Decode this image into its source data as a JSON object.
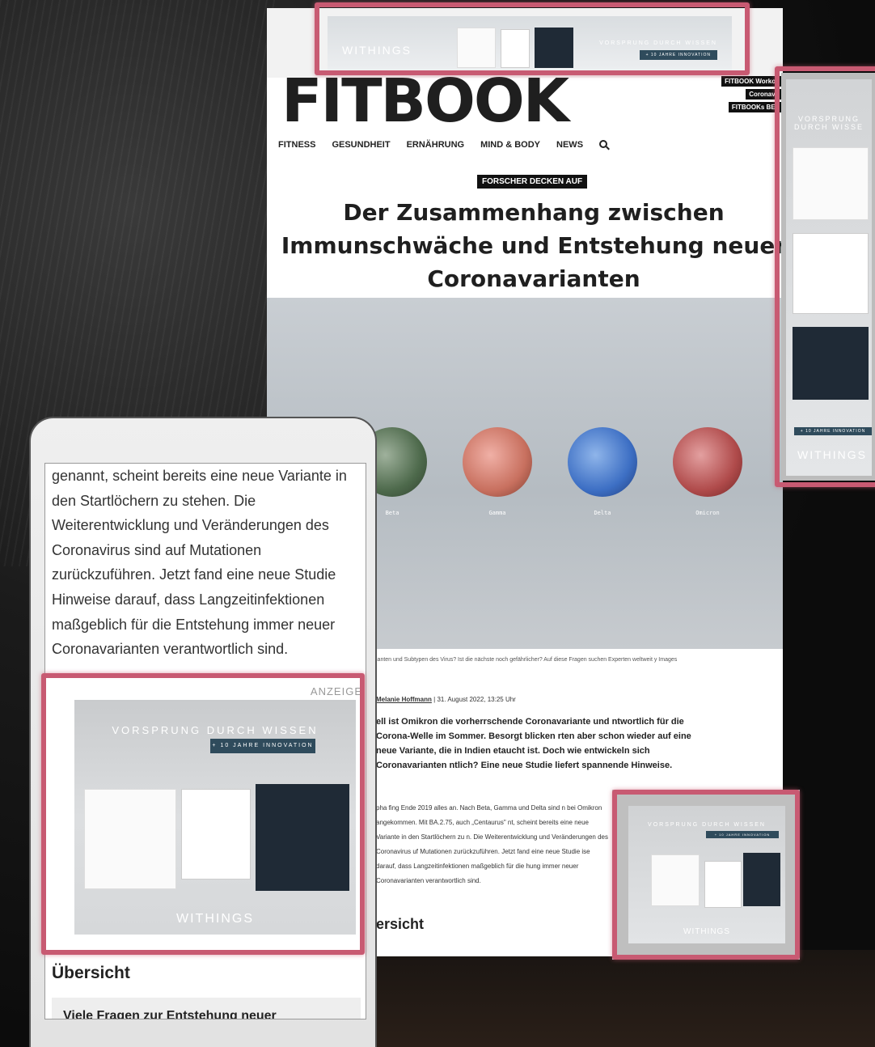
{
  "site": {
    "logo": "FITBOOK",
    "quick_links": [
      "FITBOOK Workou",
      "Coronavir",
      "FITBOOKs BES"
    ],
    "nav": [
      "FITNESS",
      "GESUNDHEIT",
      "ERNÄHRUNG",
      "MIND & BODY",
      "NEWS"
    ]
  },
  "ad_top": {
    "brand": "WITHINGS",
    "tagline": "VORSPRUNG DURCH WISSEN",
    "pill": "+ 10 JAHRE INNOVATION"
  },
  "ad_side": {
    "tagline": "VORSPRUNG DURCH WISSE",
    "pill": "+ 10 JAHRE INNOVATION",
    "brand": "WITHINGS"
  },
  "article": {
    "kicker": "FORSCHER DECKEN AUF",
    "headline": "Der Zusammenhang zwischen Immunschwäche und Entstehung neuer Coronavarianten",
    "variants": [
      "Beta",
      "Gamma",
      "Delta",
      "Omicron"
    ],
    "caption": "ianten und Subtypen des Virus? Ist die nächste noch gefährlicher? Auf diese Fragen suchen Experten weltweit y Images",
    "author": "Melanie Hoffmann",
    "date": "| 31. August 2022, 13:25 Uhr",
    "lead": "ell ist Omikron die vorherrschende Coronavariante und ntwortlich für die Corona-Welle im Sommer. Besorgt blicken rten aber schon wieder auf eine neue Variante, die in Indien etaucht ist. Doch wie entwickeln sich Coronavarianten ntlich? Eine neue Studie liefert spannende Hinweise.",
    "body": "pha fing Ende 2019 alles an. Nach Beta, Gamma und Delta sind n bei Omikron angekommen. Mit BA.2.75, auch „Centaurus\" nt, scheint bereits eine neue Variante in den Startlöchern zu n. Die Weiterentwicklung und Veränderungen des Coronavirus uf Mutationen zurückzuführen. Jetzt fand eine neue Studie ise darauf, dass Langzeitinfektionen maßgeblich für die hung immer neuer Coronavarianten verantwortlich sind.",
    "subheading": "ersicht"
  },
  "ad_bottom": {
    "tagline": "VORSPRUNG DURCH WISSEN",
    "pill": "+ 10 JAHRE INNOVATION",
    "brand": "WITHINGS"
  },
  "mobile": {
    "text": "genannt, scheint bereits eine neue Variante in den Startlöchern zu stehen. Die Weiterentwicklung und Veränderungen des Coronavirus sind auf Mutationen zurückzuführen. Jetzt fand eine neue Studie Hinweise darauf, dass Langzeitinfektionen maßgeblich für die Entstehung immer neuer Coronavarianten verantwortlich sind.",
    "ad_label": "ANZEIGE",
    "ad_tagline": "VORSPRUNG DURCH WISSEN",
    "ad_pill": "+ 10 JAHRE INNOVATION",
    "ad_brand": "WITHINGS",
    "subheading": "Übersicht",
    "box_text": "Viele Fragen zur Entstehung neuer"
  },
  "colors": {
    "highlight": "#c85a72",
    "ad_pill": "#2f4b5c"
  }
}
